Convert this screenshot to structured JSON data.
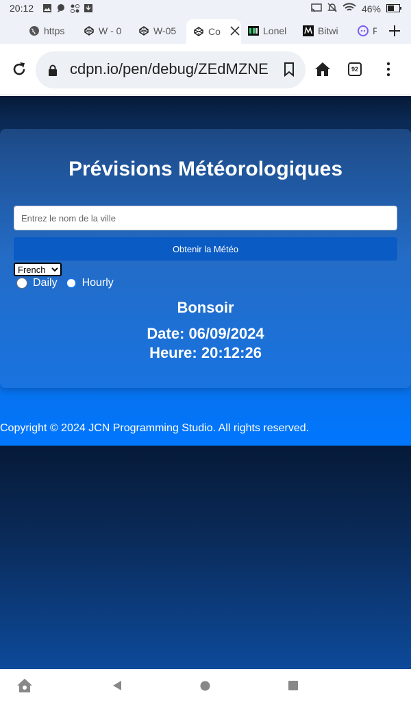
{
  "status_bar": {
    "time": "20:12",
    "battery": "46%"
  },
  "tabs": [
    {
      "label": "https"
    },
    {
      "label": "W - 0"
    },
    {
      "label": "W-05"
    },
    {
      "label": "Co"
    },
    {
      "label": "Lonel"
    },
    {
      "label": "Bitwi"
    },
    {
      "label": "F"
    }
  ],
  "toolbar": {
    "url": "cdpn.io/pen/debug/ZEdMZNE",
    "tab_count": "92"
  },
  "weather": {
    "title": "Prévisions Météorologiques",
    "city_placeholder": "Entrez le nom de la ville",
    "button_label": "Obtenir la Météo",
    "language_selected": "French",
    "radio_daily": "Daily",
    "radio_hourly": "Hourly",
    "greeting": "Bonsoir",
    "date_line": "Date: 06/09/2024",
    "time_line": "Heure: 20:12:26"
  },
  "footer": {
    "copyright": "Copyright © 2024 JCN Programming Studio. All rights reserved."
  },
  "colors": {
    "accent": "#0077ff",
    "button": "#0a5bc4",
    "page_dark": "#061a38"
  }
}
